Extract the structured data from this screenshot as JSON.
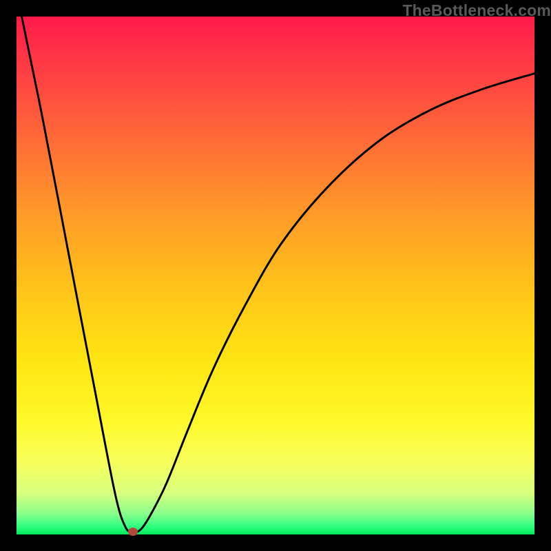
{
  "watermark": "TheBottleneck.com",
  "chart_data": {
    "type": "line",
    "title": "",
    "xlabel": "",
    "ylabel": "",
    "x_range_fraction": [
      0,
      1
    ],
    "y_range_fraction": [
      0,
      1
    ],
    "series": [
      {
        "name": "bottleneck-curve",
        "x_fraction": [
          0.01,
          0.05,
          0.1,
          0.15,
          0.19,
          0.21,
          0.225,
          0.24,
          0.26,
          0.29,
          0.33,
          0.38,
          0.44,
          0.51,
          0.6,
          0.7,
          0.8,
          0.9,
          1.0
        ],
        "y_fraction": [
          0.0,
          0.195,
          0.455,
          0.715,
          0.92,
          0.985,
          0.995,
          0.99,
          0.96,
          0.9,
          0.8,
          0.68,
          0.56,
          0.44,
          0.33,
          0.24,
          0.18,
          0.14,
          0.11
        ]
      }
    ],
    "marker": {
      "name": "highlight-dot",
      "x_fraction": 0.225,
      "y_fraction": 0.995,
      "color": "#b14a3c"
    },
    "background_gradient": {
      "top_color": "#ff1a4a",
      "bottom_color": "#00e85a",
      "description": "vertical red-to-green via orange/yellow"
    }
  }
}
